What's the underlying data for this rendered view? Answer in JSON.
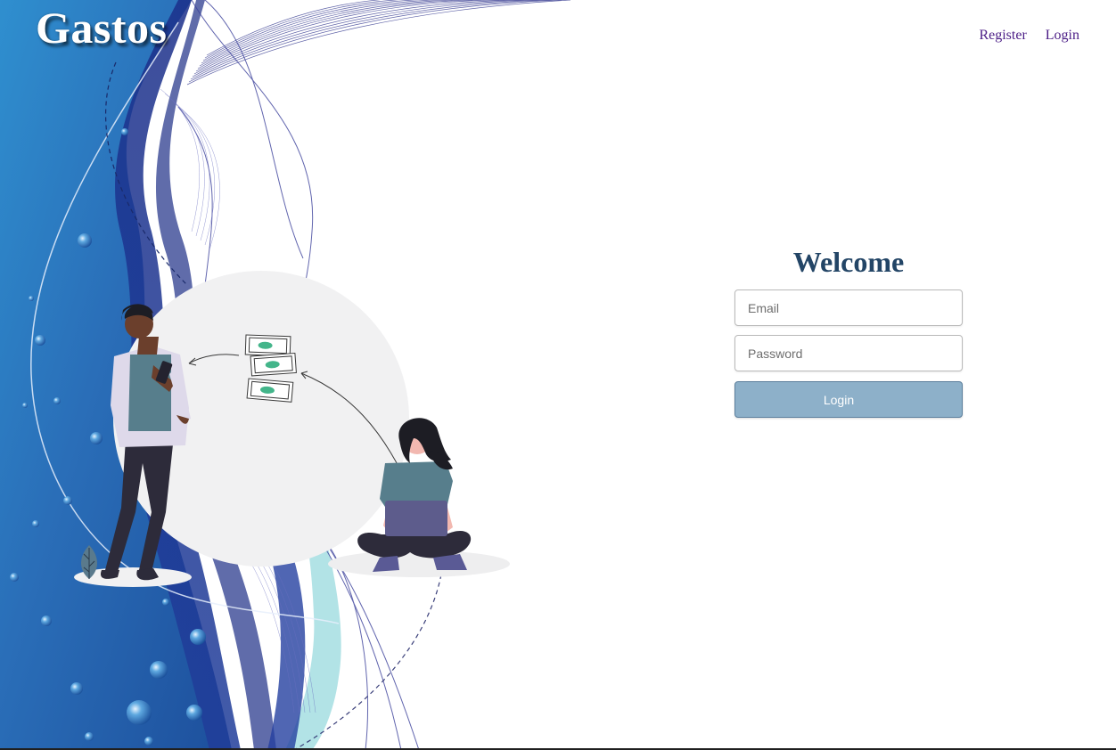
{
  "app": {
    "logo": "Gastos"
  },
  "nav": {
    "register_label": "Register",
    "login_label": "Login"
  },
  "login_form": {
    "heading": "Welcome",
    "email_placeholder": "Email",
    "password_placeholder": "Password",
    "submit_label": "Login"
  },
  "colors": {
    "heading": "#234566",
    "nav_link": "#4b1d86",
    "button": "#8db0c9",
    "background_wave": "#1f57a6"
  },
  "illustration": {
    "icons": [
      "wave-background",
      "man-with-phone",
      "woman-with-laptop",
      "money-bills",
      "leaf-plant"
    ]
  }
}
